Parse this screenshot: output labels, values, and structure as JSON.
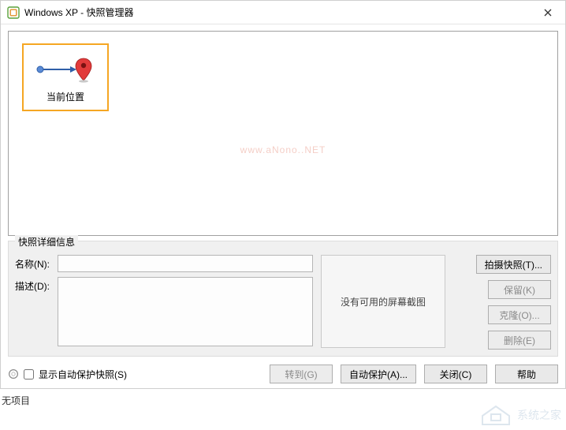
{
  "titlebar": {
    "title": "Windows XP - 快照管理器"
  },
  "snapshot_tree": {
    "current_node_label": "当前位置"
  },
  "watermark": "www.aNono..NET",
  "details": {
    "legend": "快照详细信息",
    "name_label": "名称(N):",
    "name_value": "",
    "desc_label": "描述(D):",
    "desc_value": "",
    "thumbnail_text": "没有可用的屏幕截图",
    "buttons": {
      "take": "拍摄快照(T)...",
      "keep": "保留(K)",
      "clone": "克隆(O)...",
      "delete": "删除(E)"
    }
  },
  "bottom": {
    "show_autoprotect_label": "显示自动保护快照(S)",
    "goto": "转到(G)",
    "autoprotect": "自动保护(A)...",
    "close": "关闭(C)",
    "help": "帮助"
  },
  "status": {
    "text": "无项目"
  },
  "brand_watermark": "系统之家"
}
